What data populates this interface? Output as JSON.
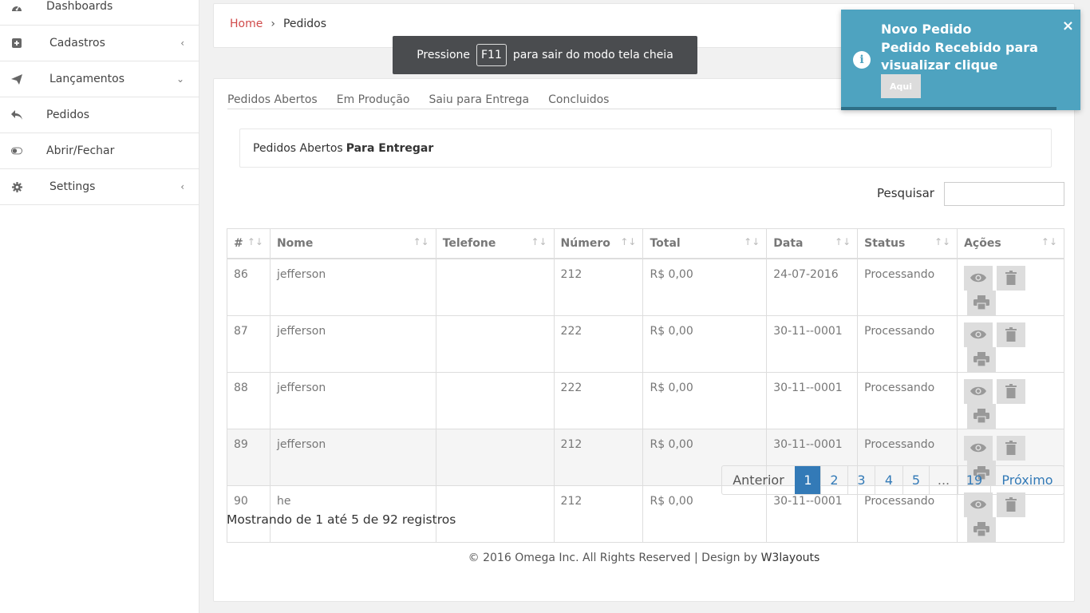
{
  "sidebar": {
    "items": [
      {
        "label": "Dashboards",
        "icon": "dashboard-icon",
        "arrow": ""
      },
      {
        "label": "Cadastros",
        "icon": "plus-square-icon",
        "arrow": "‹"
      },
      {
        "label": "Lançamentos",
        "icon": "paper-plane-icon",
        "arrow": "⌄"
      },
      {
        "label": "Pedidos",
        "icon": "reply-icon",
        "arrow": ""
      },
      {
        "label": "Abrir/Fechar",
        "icon": "toggle-icon",
        "arrow": ""
      },
      {
        "label": "Settings",
        "icon": "gear-icon",
        "arrow": "‹"
      }
    ]
  },
  "breadcrumb": {
    "home": "Home",
    "separator": "›",
    "current": "Pedidos"
  },
  "fullscreen_hint": {
    "before": "Pressione",
    "key": "F11",
    "after": "para sair do modo tela cheia"
  },
  "tabs": [
    "Pedidos Abertos",
    "Em Produção",
    "Saiu para Entrega",
    "Concluidos"
  ],
  "info_box": {
    "text": "Pedidos Abertos",
    "bold": "Para Entregar"
  },
  "search": {
    "label": "Pesquisar",
    "value": ""
  },
  "table": {
    "headers": [
      "#",
      "Nome",
      "Telefone",
      "Número",
      "Total",
      "Data",
      "Status",
      "Ações"
    ],
    "sort_glyph": "↑↓",
    "rows": [
      {
        "id": "86",
        "nome": "jefferson",
        "telefone": "",
        "numero": "212",
        "total": "R$ 0,00",
        "data": "24-07-2016",
        "status": "Processando"
      },
      {
        "id": "87",
        "nome": "jefferson",
        "telefone": "",
        "numero": "222",
        "total": "R$ 0,00",
        "data": "30-11--0001",
        "status": "Processando"
      },
      {
        "id": "88",
        "nome": "jefferson",
        "telefone": "",
        "numero": "222",
        "total": "R$ 0,00",
        "data": "30-11--0001",
        "status": "Processando"
      },
      {
        "id": "89",
        "nome": "jefferson",
        "telefone": "",
        "numero": "212",
        "total": "R$ 0,00",
        "data": "30-11--0001",
        "status": "Processando"
      },
      {
        "id": "90",
        "nome": "he",
        "telefone": "",
        "numero": "212",
        "total": "R$ 0,00",
        "data": "30-11--0001",
        "status": "Processando"
      }
    ]
  },
  "pagination": {
    "prev": "Anterior",
    "pages": [
      "1",
      "2",
      "3",
      "4",
      "5",
      "...",
      "19"
    ],
    "next": "Próximo",
    "active": "1"
  },
  "showing": "Mostrando de 1 até 5 de 92 registros",
  "footer": {
    "text": "© 2016 Omega Inc. All Rights Reserved | Design by",
    "brand": "W3layouts"
  },
  "toast": {
    "title": "Novo Pedido",
    "message": "Pedido Recebido para visualizar clique",
    "button": "Aqui",
    "close": "×",
    "progress": 0.9
  },
  "colors": {
    "toast_bg": "#4ea3c0",
    "accent": "#337ab7",
    "home_link": "#d04a4a"
  }
}
